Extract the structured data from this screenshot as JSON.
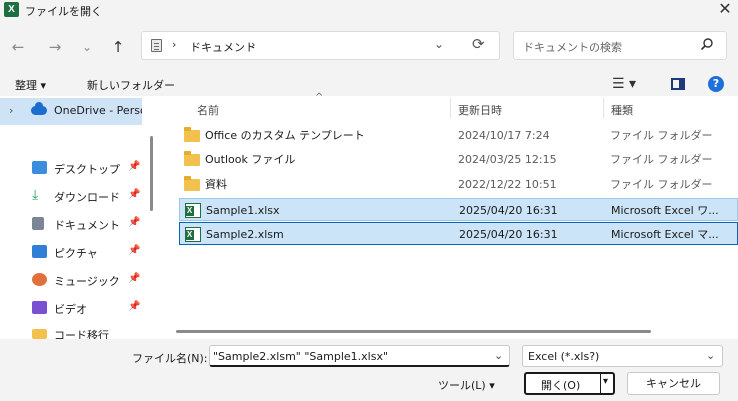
{
  "window": {
    "title": "ファイルを開く",
    "app_icon": "excel-icon",
    "close_glyph": "✕"
  },
  "nav": {
    "back_glyph": "←",
    "forward_glyph": "→",
    "recent_glyph": "⌄",
    "up_glyph": "↑"
  },
  "address": {
    "sep1": "›",
    "path": "ドキュメント",
    "sep2": "›",
    "drop_glyph": "⌄",
    "refresh_glyph": "⟳"
  },
  "search": {
    "placeholder": "ドキュメントの検索"
  },
  "toolbar": {
    "organize": "整理 ▾",
    "new_folder": "新しいフォルダー",
    "view_glyph": "☰ ▾",
    "help_glyph": "?"
  },
  "sidebar": {
    "onedrive": "OneDrive - Personal",
    "items": [
      {
        "label": "デスクトップ",
        "icon": "desktop-icon",
        "color": "#3b8ede",
        "pinned": true
      },
      {
        "label": "ダウンロード",
        "icon": "download-icon",
        "color": "#2e9d5a",
        "pinned": true
      },
      {
        "label": "ドキュメント",
        "icon": "documents-icon",
        "color": "#7a8596",
        "pinned": true
      },
      {
        "label": "ピクチャ",
        "icon": "pictures-icon",
        "color": "#2f7fd6",
        "pinned": true
      },
      {
        "label": "ミュージック",
        "icon": "music-icon",
        "color": "#e0703c",
        "pinned": true
      },
      {
        "label": "ビデオ",
        "icon": "videos-icon",
        "color": "#7a4fd1",
        "pinned": true
      },
      {
        "label": "コード移行",
        "icon": "folder-icon",
        "color": "#f2c14e",
        "pinned": false
      }
    ],
    "pin_glyph": "📌"
  },
  "columns": {
    "name": "名前",
    "date": "更新日時",
    "type": "種類",
    "sort_glyph": "^"
  },
  "files": [
    {
      "name": "Office のカスタム テンプレート",
      "date": "2024/10/17 7:24",
      "type": "ファイル フォルダー",
      "kind": "folder"
    },
    {
      "name": "Outlook ファイル",
      "date": "2024/03/25 12:15",
      "type": "ファイル フォルダー",
      "kind": "folder"
    },
    {
      "name": "資料",
      "date": "2022/12/22 10:51",
      "type": "ファイル フォルダー",
      "kind": "folder"
    },
    {
      "name": "Sample1.xlsx",
      "date": "2025/04/20 16:31",
      "type": "Microsoft Excel ワ...",
      "kind": "excel",
      "selected": true
    },
    {
      "name": "Sample2.xlsm",
      "date": "2025/04/20 16:31",
      "type": "Microsoft Excel マ...",
      "kind": "excel",
      "selected": true
    }
  ],
  "footer": {
    "filename_label": "ファイル名(N):",
    "filename_value": "\"Sample2.xlsm\" \"Sample1.xlsx\"",
    "filter_value": "Excel (*.xls?)",
    "tools_label": "ツール(L)   ▾",
    "open_label": "開く(O)",
    "open_drop": "▾",
    "cancel_label": "キャンセル",
    "drop_glyph": "⌄"
  }
}
